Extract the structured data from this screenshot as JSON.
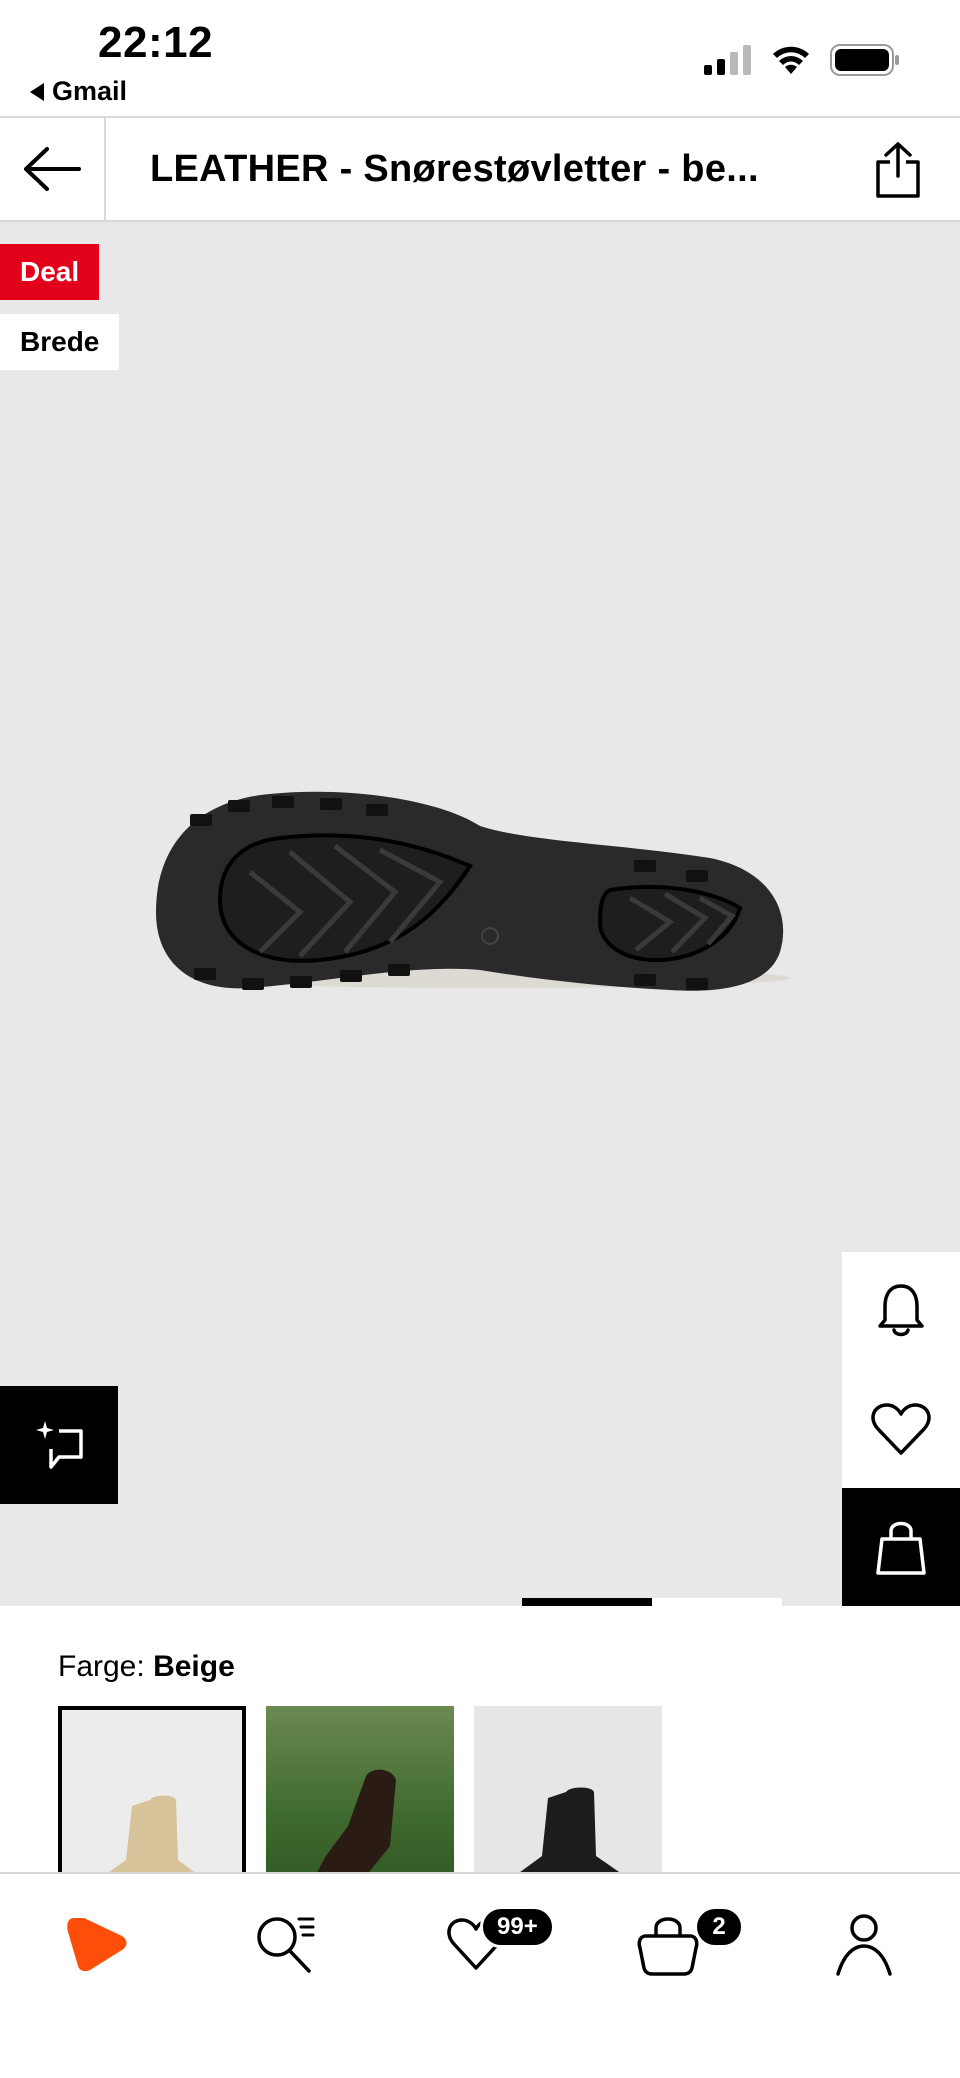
{
  "status_bar": {
    "time": "22:12",
    "back_app": "Gmail"
  },
  "header": {
    "title": "LEATHER - Snørestøvletter - be..."
  },
  "gallery": {
    "badges": [
      "Deal",
      "Brede"
    ],
    "deal_color": "#e2001a",
    "image_description_icon": "shoe-sole-image"
  },
  "color_picker": {
    "label": "Farge:",
    "value": "Beige",
    "swatches": [
      "beige",
      "dark-brown",
      "black"
    ],
    "selected_index": 0
  },
  "bottom_nav": {
    "wishlist_count": "99+",
    "bag_count": "2",
    "brand_color": "#ff4e0a"
  }
}
